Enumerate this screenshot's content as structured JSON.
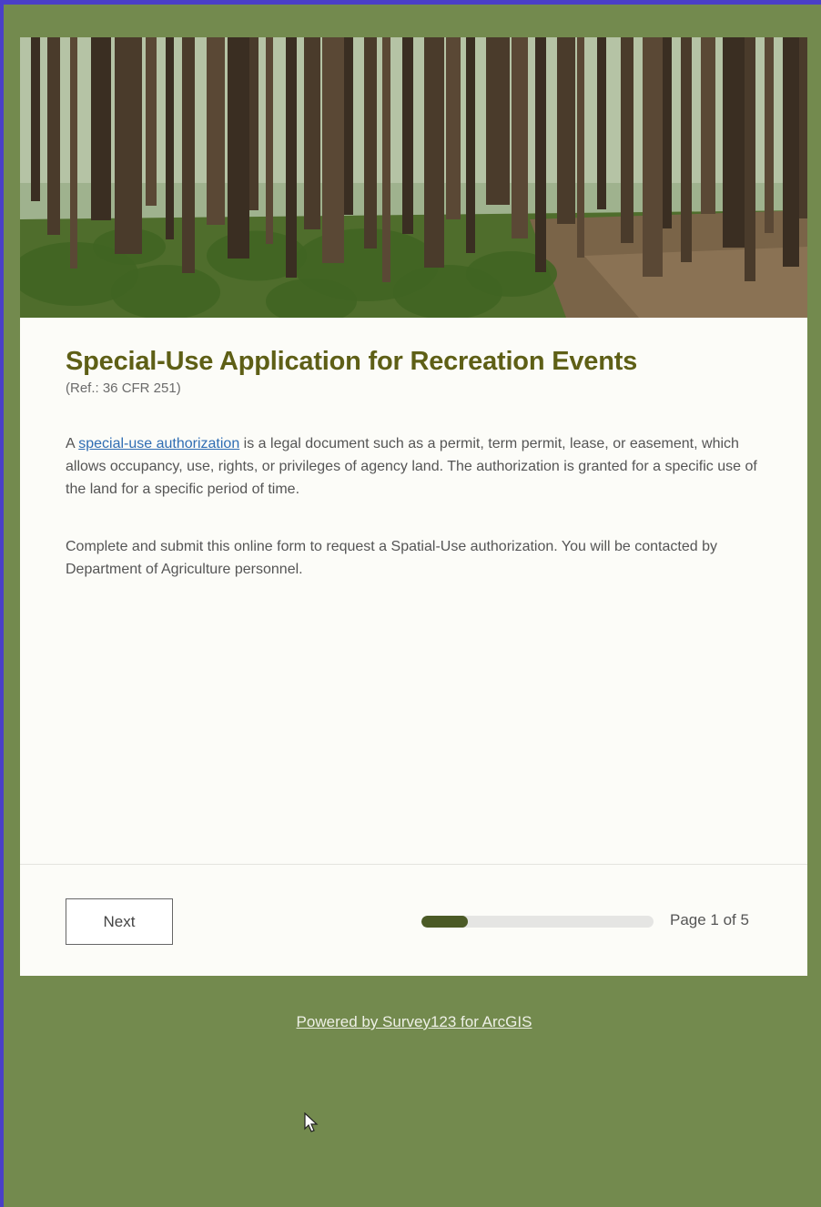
{
  "banner": {
    "icon": "forest-photo"
  },
  "form": {
    "title": "Special-Use Application for Recreation Events",
    "ref": "(Ref.: 36 CFR 251)",
    "intro_prefix": "A ",
    "intro_link": "special-use authorization",
    "intro_suffix": " is a legal document such as a permit, term permit, lease, or easement, which allows occupancy, use, rights, or privileges of agency land. The authorization is granted for a specific use of the land for a specific period of time.",
    "instructions": "Complete and submit this online form to request a Spatial-Use authorization. You will be contacted by Department of Agriculture personnel."
  },
  "footer": {
    "next_label": "Next",
    "page_label": "Page 1 of 5",
    "progress_fraction": 0.2
  },
  "powered_by": "Powered by Survey123 for ArcGIS",
  "colors": {
    "background": "#738a4e",
    "title": "#5e5f16",
    "link": "#2f6db3",
    "progress_fill": "#4b5a26"
  }
}
